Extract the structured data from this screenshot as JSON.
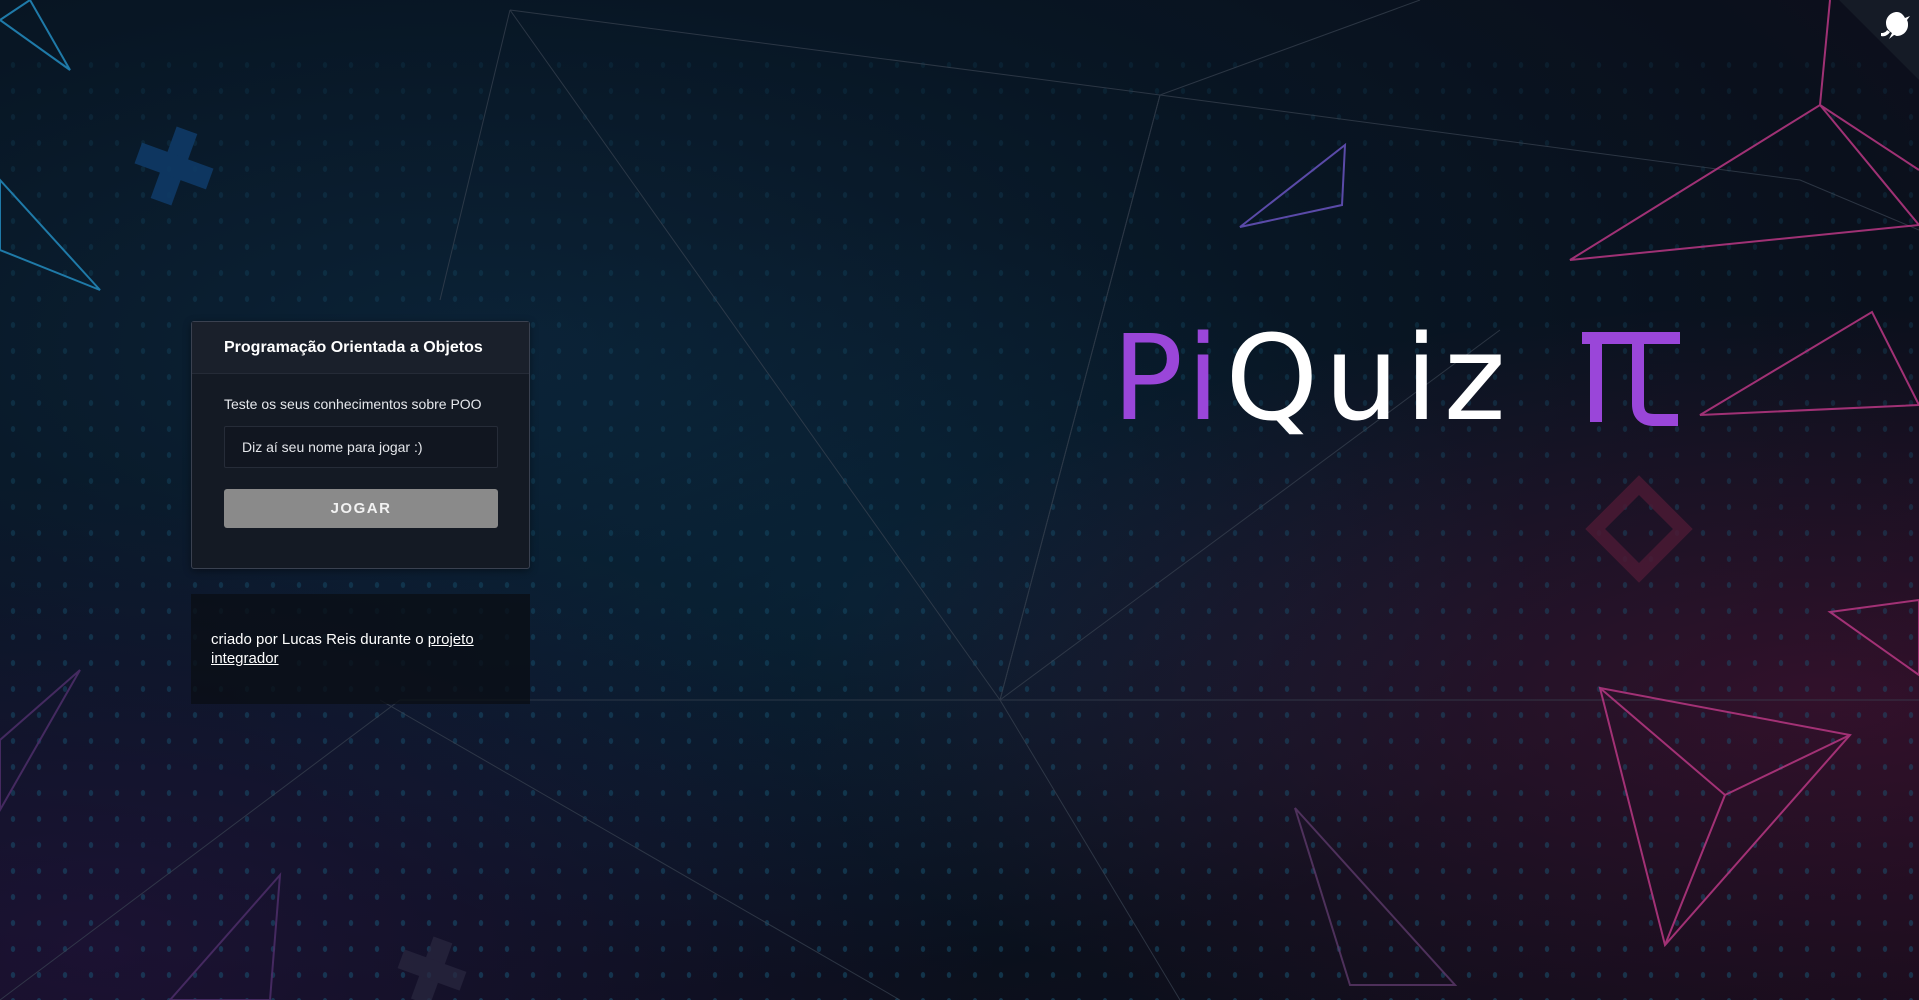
{
  "card": {
    "title": "Programação Orientada a Objetos",
    "subtitle": "Teste os seus conhecimentos sobre POO",
    "input_placeholder": "Diz aí seu nome para jogar :)",
    "input_value": "",
    "play_label": "JOGAR"
  },
  "credit": {
    "text_prefix": "criado por Lucas Reis durante o ",
    "link_text": "projeto integrador"
  },
  "logo": {
    "pi_text": "Pi",
    "quiz_text": "Quiz",
    "symbol": "pi-symbol-icon"
  },
  "github_corner": {
    "icon": "github-octocat-icon"
  },
  "colors": {
    "accent_purple": "#9a46d9",
    "button_gray": "#8a8a8a",
    "card_bg": "#141a24"
  }
}
